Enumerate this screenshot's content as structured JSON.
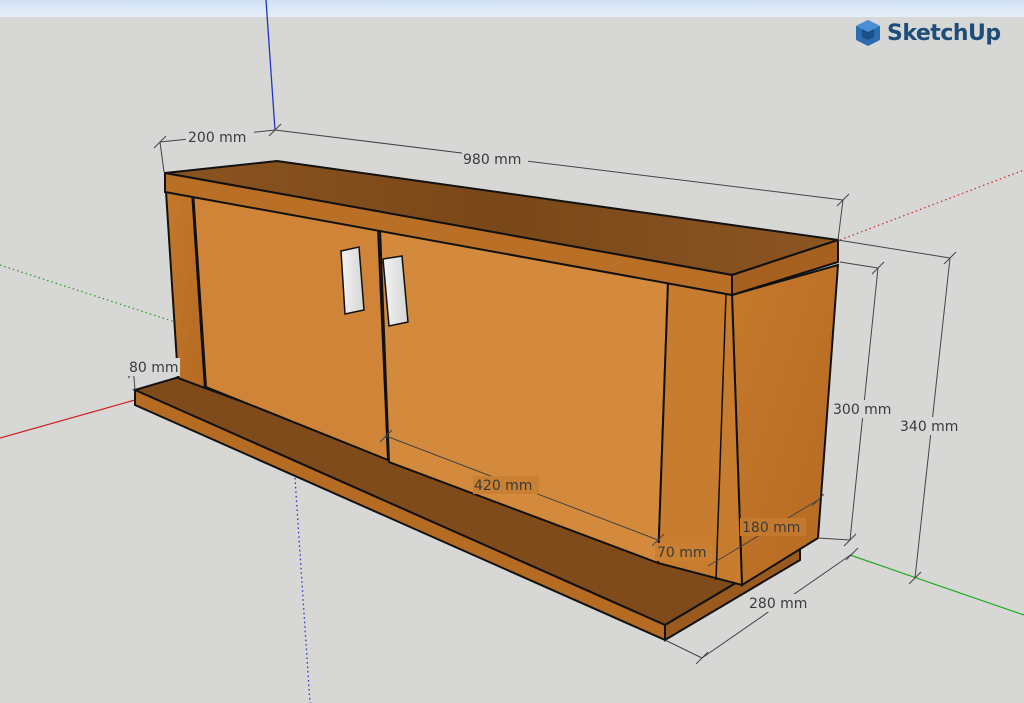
{
  "app": {
    "brand_name": "SketchUp",
    "logo_icon": "sketchup-logo-icon",
    "colors": {
      "background": "#d7d8d5",
      "axis_red": "#cc2222",
      "axis_green": "#22aa22",
      "axis_blue": "#2222cc",
      "wood": "#c97d2a",
      "wood_dark": "#7a4718"
    }
  },
  "dimensions": {
    "top_depth": "200 mm",
    "top_width": "980 mm",
    "base_height": "80 mm",
    "inner_height": "300 mm",
    "total_height": "340 mm",
    "door_width": "420 mm",
    "side_panel": "70 mm",
    "side_depth": "180 mm",
    "base_depth": "280 mm"
  }
}
